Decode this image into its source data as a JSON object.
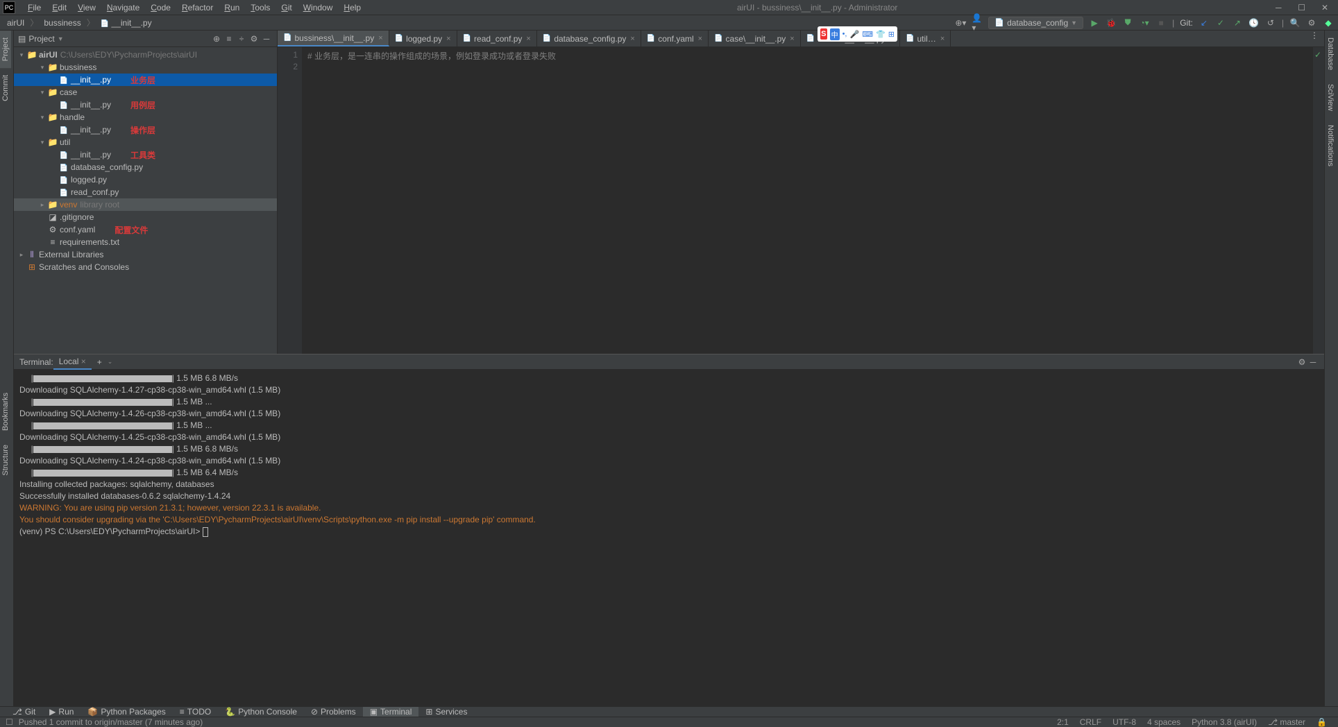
{
  "window": {
    "title": "airUI - bussiness\\__init__.py - Administrator",
    "minimize": "─",
    "maximize": "☐",
    "close": "✕"
  },
  "menus": [
    "File",
    "Edit",
    "View",
    "Navigate",
    "Code",
    "Refactor",
    "Run",
    "Tools",
    "Git",
    "Window",
    "Help"
  ],
  "breadcrumb": [
    "airUI",
    "bussiness",
    "__init__.py"
  ],
  "run_config": "database_config",
  "git_label": "Git:",
  "project": {
    "title": "Project",
    "root": {
      "name": "airUI",
      "path": "C:\\Users\\EDY\\PycharmProjects\\airUI"
    },
    "items": [
      {
        "indent": 1,
        "arrow": "▾",
        "icon": "📁",
        "name": "bussiness",
        "annot": ""
      },
      {
        "indent": 2,
        "arrow": "",
        "icon": "py",
        "name": "__init__.py",
        "annot": "业务层",
        "sel": true
      },
      {
        "indent": 1,
        "arrow": "▾",
        "icon": "📁",
        "name": "case",
        "annot": ""
      },
      {
        "indent": 2,
        "arrow": "",
        "icon": "py",
        "name": "__init__.py",
        "annot": "用例层"
      },
      {
        "indent": 1,
        "arrow": "▾",
        "icon": "📁",
        "name": "handle",
        "annot": ""
      },
      {
        "indent": 2,
        "arrow": "",
        "icon": "py",
        "name": "__init__.py",
        "annot": "操作层"
      },
      {
        "indent": 1,
        "arrow": "▾",
        "icon": "📁",
        "name": "util",
        "annot": ""
      },
      {
        "indent": 2,
        "arrow": "",
        "icon": "py",
        "name": "__init__.py",
        "annot": "工具类"
      },
      {
        "indent": 2,
        "arrow": "",
        "icon": "py",
        "name": "database_config.py"
      },
      {
        "indent": 2,
        "arrow": "",
        "icon": "py",
        "name": "logged.py"
      },
      {
        "indent": 2,
        "arrow": "",
        "icon": "py",
        "name": "read_conf.py"
      },
      {
        "indent": 1,
        "arrow": "▸",
        "icon": "📁",
        "name": "venv",
        "sub": "library root",
        "libroot": true
      },
      {
        "indent": 1,
        "arrow": "",
        "icon": "◪",
        "name": ".gitignore"
      },
      {
        "indent": 1,
        "arrow": "",
        "icon": "⚙",
        "name": "conf.yaml",
        "annot": "配置文件"
      },
      {
        "indent": 1,
        "arrow": "",
        "icon": "≡",
        "name": "requirements.txt"
      }
    ],
    "extlib": "External Libraries",
    "scratch": "Scratches and Consoles"
  },
  "tabs": [
    {
      "name": "bussiness\\__init__.py",
      "active": true,
      "icon": "py"
    },
    {
      "name": "logged.py",
      "icon": "py"
    },
    {
      "name": "read_conf.py",
      "icon": "py"
    },
    {
      "name": "database_config.py",
      "icon": "py"
    },
    {
      "name": "conf.yaml",
      "icon": "⚙"
    },
    {
      "name": "case\\__init__.py",
      "icon": "py"
    },
    {
      "name": "handle\\__init__.py",
      "icon": "py"
    },
    {
      "name": "util",
      "icon": "py",
      "cut": true
    }
  ],
  "code": {
    "lines": [
      "1",
      "2"
    ],
    "l1": "# 业务层，是一连串的操作组成的场景，例如登录成功或者登录失败"
  },
  "terminal": {
    "title": "Terminal:",
    "tab": "Local",
    "lines": [
      {
        "t": "bar",
        "post": "| 1.5 MB 6.8 MB/s"
      },
      {
        "t": "txt",
        "text": "  Downloading SQLAlchemy-1.4.27-cp38-cp38-win_amd64.whl (1.5 MB)"
      },
      {
        "t": "bar",
        "post": "| 1.5 MB ..."
      },
      {
        "t": "txt",
        "text": "  Downloading SQLAlchemy-1.4.26-cp38-cp38-win_amd64.whl (1.5 MB)"
      },
      {
        "t": "bar",
        "post": "| 1.5 MB ..."
      },
      {
        "t": "txt",
        "text": "  Downloading SQLAlchemy-1.4.25-cp38-cp38-win_amd64.whl (1.5 MB)"
      },
      {
        "t": "bar",
        "post": "| 1.5 MB 6.8 MB/s"
      },
      {
        "t": "txt",
        "text": "  Downloading SQLAlchemy-1.4.24-cp38-cp38-win_amd64.whl (1.5 MB)"
      },
      {
        "t": "bar",
        "post": "| 1.5 MB 6.4 MB/s"
      },
      {
        "t": "txt",
        "text": "Installing collected packages: sqlalchemy, databases"
      },
      {
        "t": "txt",
        "text": "Successfully installed databases-0.6.2 sqlalchemy-1.4.24"
      },
      {
        "t": "warn",
        "text": "WARNING: You are using pip version 21.3.1; however, version 22.3.1 is available."
      },
      {
        "t": "warn",
        "text": "You should consider upgrading via the 'C:\\Users\\EDY\\PycharmProjects\\airUI\\venv\\Scripts\\python.exe -m pip install --upgrade pip' command."
      },
      {
        "t": "prompt",
        "text": "(venv) PS C:\\Users\\EDY\\PycharmProjects\\airUI> "
      }
    ]
  },
  "bottom_tools": [
    {
      "label": "Git",
      "icon": "⎇"
    },
    {
      "label": "Run",
      "icon": "▶"
    },
    {
      "label": "Python Packages",
      "icon": "📦"
    },
    {
      "label": "TODO",
      "icon": "≡"
    },
    {
      "label": "Python Console",
      "icon": "🐍"
    },
    {
      "label": "Problems",
      "icon": "⊘"
    },
    {
      "label": "Terminal",
      "icon": "▣",
      "active": true
    },
    {
      "label": "Services",
      "icon": "⊞"
    }
  ],
  "status": {
    "msg": "Pushed 1 commit to origin/master (7 minutes ago)",
    "pos": "2:1",
    "sep": "CRLF",
    "enc": "UTF-8",
    "indent": "4 spaces",
    "interp": "Python 3.8 (airUI)",
    "branch": "master",
    "branch_icon": "⎇",
    "lock": "🔒"
  },
  "left_tabs": [
    "Project",
    "Commit",
    "Bookmarks",
    "Structure"
  ],
  "right_tabs": [
    "Database",
    "SciView",
    "Notifications"
  ],
  "ime": {
    "ch": "中"
  }
}
